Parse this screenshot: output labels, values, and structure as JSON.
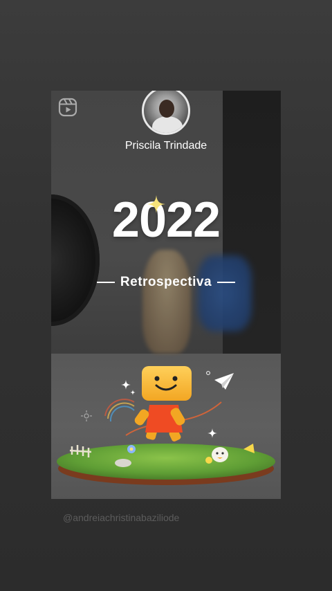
{
  "story": {
    "user": {
      "name": "Priscila Trindade"
    },
    "title": {
      "year": "2022",
      "subtitle": "Retrospectiva"
    }
  },
  "watermark": "@andreiachristinabaziliode",
  "colors": {
    "page_bg": "#353535",
    "text": "#ffffff",
    "mascot_head": "#f7b531",
    "mascot_body": "#ef4b23",
    "grass": "#6fae3a"
  },
  "icons": {
    "reels": "reels-icon",
    "sparkle": "sparkle-icon",
    "paper_plane": "paper-plane-icon"
  }
}
